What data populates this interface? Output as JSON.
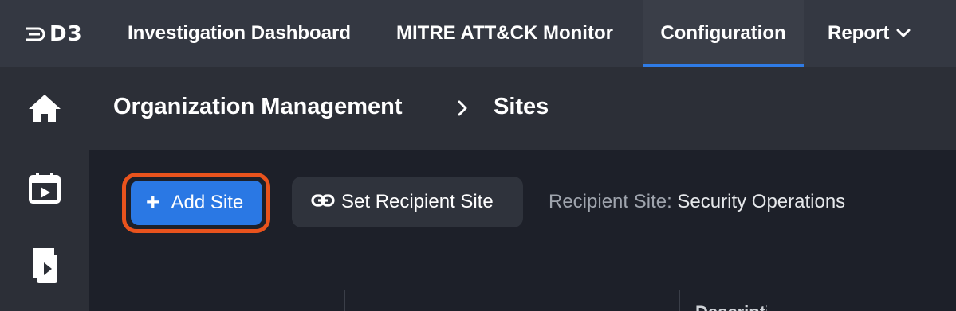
{
  "app": {
    "logo_text": "D3",
    "brand_color": "#2f7be5"
  },
  "topnav": {
    "items": [
      {
        "label": "Investigation Dashboard",
        "active": false
      },
      {
        "label": "MITRE ATT&CK Monitor",
        "active": false
      },
      {
        "label": "Configuration",
        "active": true
      },
      {
        "label": "Report",
        "active": false,
        "has_dropdown": true
      }
    ]
  },
  "sidebar": {
    "icons": [
      "home-icon",
      "calendar-play-icon",
      "playbook-icon"
    ]
  },
  "breadcrumb": {
    "parent": "Organization Management",
    "separator_icon": "chevron-right-icon",
    "current": "Sites"
  },
  "toolbar": {
    "add_site_label": "Add Site",
    "add_site_icon": "plus-icon",
    "set_recipient_label": "Set Recipient Site",
    "set_recipient_icon": "link-icon",
    "recipient_label": "Recipient Site:",
    "recipient_value": "Security Operations",
    "highlight_color": "#e9531d"
  },
  "table": {
    "partial_header": "Description"
  }
}
